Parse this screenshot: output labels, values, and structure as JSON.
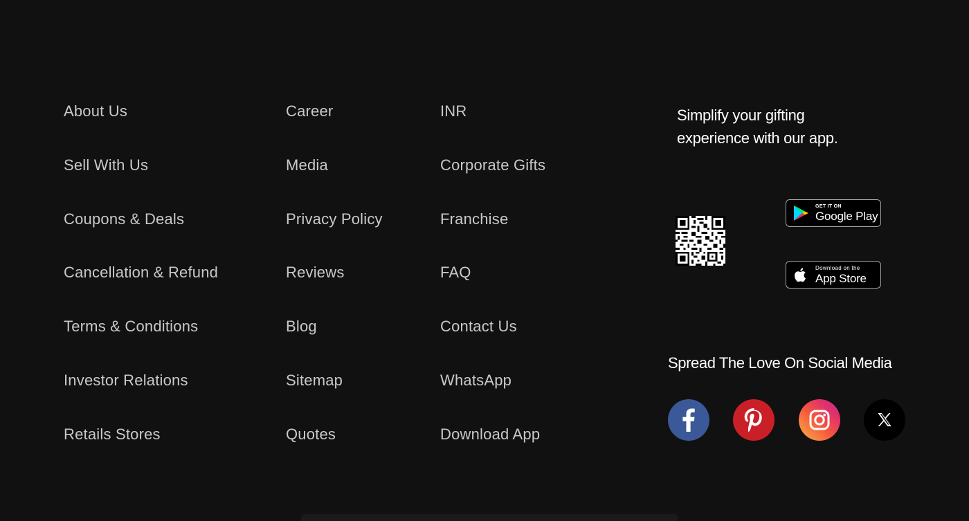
{
  "footer": {
    "column_1": [
      "About Us",
      "Sell With Us",
      "Coupons & Deals",
      "Cancellation & Refund",
      "Terms & Conditions",
      "Investor Relations",
      "Retails Stores"
    ],
    "column_2": [
      "Career",
      "Media",
      "Privacy Policy",
      "Reviews",
      "Blog",
      "Sitemap",
      "Quotes"
    ],
    "column_3": [
      "INR",
      "Corporate Gifts",
      "Franchise",
      "FAQ",
      "Contact Us",
      "WhatsApp",
      "Download App"
    ]
  },
  "app": {
    "tagline_line1": "Simplify your gifting",
    "tagline_line2": "experience with our app.",
    "qr_icon": "qr-code",
    "google_play": {
      "small_text": "GET IT ON",
      "big_text": "Google Play",
      "icon": "google-play-icon"
    },
    "app_store": {
      "small_text": "Download on the",
      "big_text": "App Store",
      "icon": "apple-icon"
    }
  },
  "social": {
    "title": "Spread The Love On Social Media",
    "items": [
      {
        "name": "facebook",
        "icon": "facebook-icon",
        "color": "#3b5998"
      },
      {
        "name": "pinterest",
        "icon": "pinterest-icon",
        "color": "#cb1f27"
      },
      {
        "name": "instagram",
        "icon": "instagram-icon",
        "color": "#e4405f"
      },
      {
        "name": "x",
        "icon": "x-icon",
        "color": "#000000"
      }
    ]
  },
  "colors": {
    "background": "#111111",
    "link_text": "#c9c9c9",
    "heading_text": "#ffffff"
  }
}
